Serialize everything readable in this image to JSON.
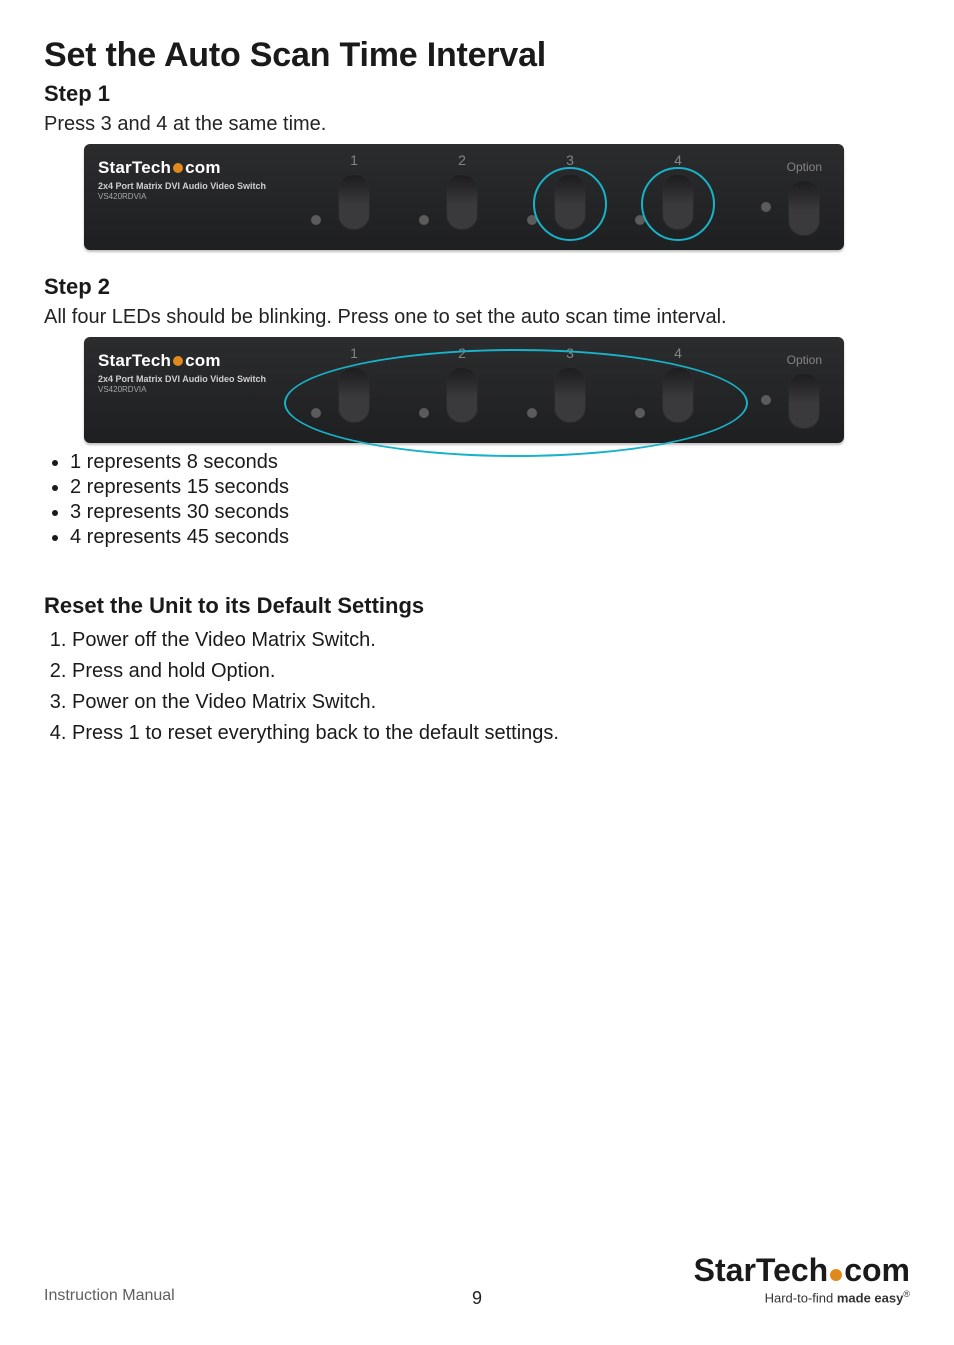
{
  "title": "Set the Auto Scan Time Interval",
  "step1": {
    "heading": "Step 1",
    "text": "Press 3 and 4 at the same time."
  },
  "step2": {
    "heading": "Step 2",
    "text": "All four LEDs should be blinking. Press one to set the auto scan time interval."
  },
  "device": {
    "brand_pre": "StarTech",
    "brand_post": "com",
    "product_line": "2x4 Port Matrix DVI Audio Video Switch",
    "model": "VS420RDVIA",
    "ports": [
      "1",
      "2",
      "3",
      "4"
    ],
    "option_label": "Option"
  },
  "bullets": [
    "1 represents 8 seconds",
    "2 represents 15 seconds",
    "3 represents 30 seconds",
    "4 represents 45 seconds"
  ],
  "reset": {
    "heading": "Reset the Unit to its Default Settings",
    "steps": [
      "Power off the Video Matrix Switch.",
      "Press and hold Option.",
      "Power on the Video Matrix Switch.",
      "Press 1 to reset everything back to the default settings."
    ]
  },
  "footer": {
    "left": "Instruction Manual",
    "page": "9",
    "brand_pre": "StarTech",
    "brand_post": "com",
    "tagline_a": "Hard-to-find ",
    "tagline_b": "made easy",
    "reg": "®"
  }
}
